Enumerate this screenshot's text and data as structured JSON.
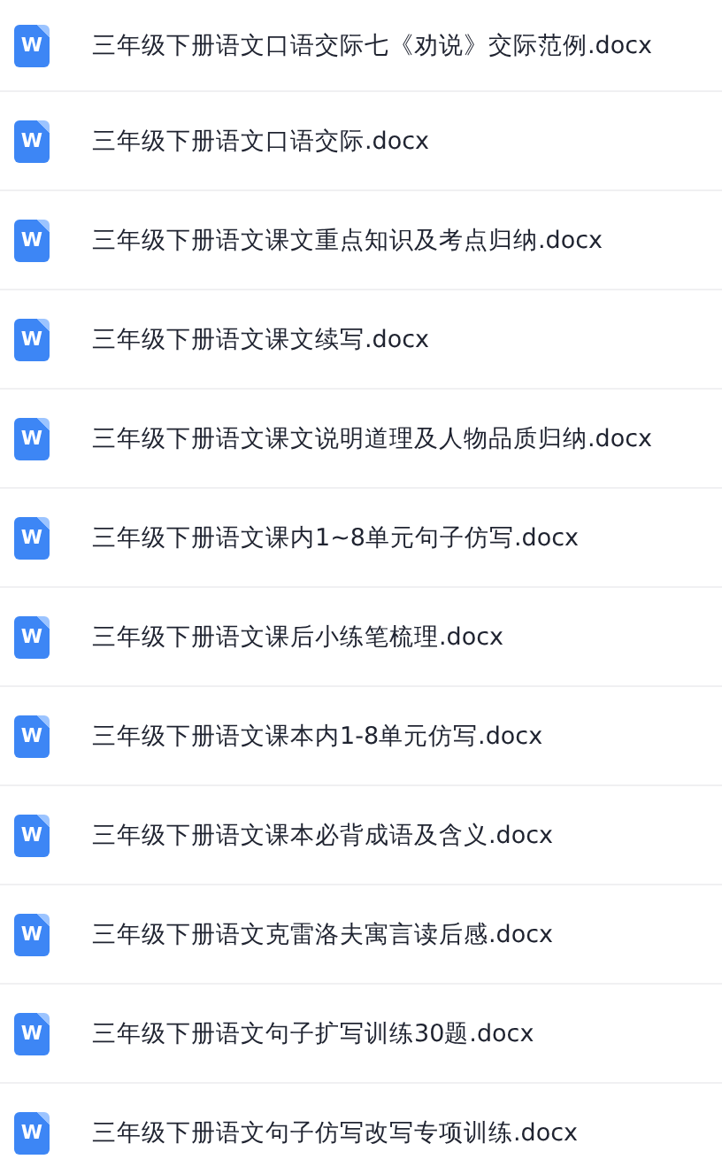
{
  "files": [
    {
      "icon_label": "W",
      "name": "三年级下册语文口语交际七《劝说》交际范例.docx"
    },
    {
      "icon_label": "W",
      "name": "三年级下册语文口语交际.docx"
    },
    {
      "icon_label": "W",
      "name": "三年级下册语文课文重点知识及考点归纳.docx"
    },
    {
      "icon_label": "W",
      "name": "三年级下册语文课文续写.docx"
    },
    {
      "icon_label": "W",
      "name": "三年级下册语文课文说明道理及人物品质归纳.docx"
    },
    {
      "icon_label": "W",
      "name": "三年级下册语文课内1~8单元句子仿写.docx"
    },
    {
      "icon_label": "W",
      "name": "三年级下册语文课后小练笔梳理.docx"
    },
    {
      "icon_label": "W",
      "name": "三年级下册语文课本内1-8单元仿写.docx"
    },
    {
      "icon_label": "W",
      "name": "三年级下册语文课本必背成语及含义.docx"
    },
    {
      "icon_label": "W",
      "name": "三年级下册语文克雷洛夫寓言读后感.docx"
    },
    {
      "icon_label": "W",
      "name": "三年级下册语文句子扩写训练30题.docx"
    },
    {
      "icon_label": "W",
      "name": "三年级下册语文句子仿写改写专项训练.docx"
    }
  ]
}
